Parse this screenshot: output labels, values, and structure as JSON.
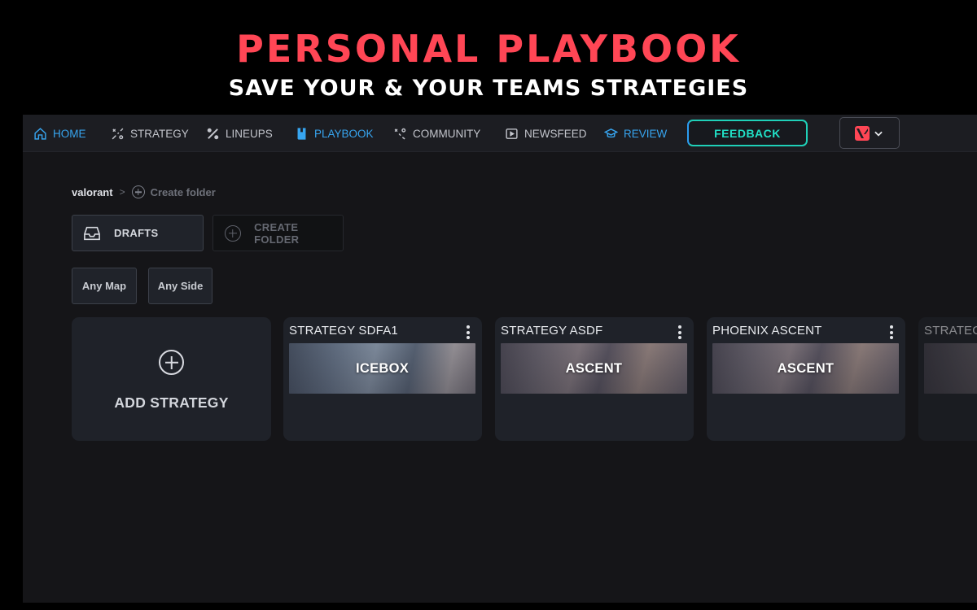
{
  "hero": {
    "title": "PERSONAL PLAYBOOK",
    "subtitle": "SAVE YOUR & YOUR TEAMS STRATEGIES"
  },
  "nav": {
    "items": [
      {
        "label": "HOME",
        "icon": "home-icon",
        "active": true
      },
      {
        "label": "STRATEGY",
        "icon": "strategy-icon",
        "active": false
      },
      {
        "label": "LINEUPS",
        "icon": "lineups-icon",
        "active": false
      },
      {
        "label": "PLAYBOOK",
        "icon": "book-icon",
        "active": true
      },
      {
        "label": "COMMUNITY",
        "icon": "community-icon",
        "active": false
      },
      {
        "label": "NEWSFEED",
        "icon": "play-icon",
        "active": false
      },
      {
        "label": "REVIEW",
        "icon": "graduation-cap-icon",
        "active": true
      }
    ],
    "feedback_label": "FEEDBACK",
    "game_select": {
      "icon": "valorant-logo",
      "chevron": "chevron-down-icon"
    }
  },
  "breadcrumb": {
    "root": "valorant",
    "separator": ">",
    "create_folder": "Create folder"
  },
  "folders": {
    "drafts": "DRAFTS",
    "create": "CREATE FOLDER"
  },
  "filters": {
    "map": "Any Map",
    "side": "Any Side"
  },
  "add_strategy_label": "ADD STRATEGY",
  "strategies": [
    {
      "title": "STRATEGY SDFA1",
      "map": "ICEBOX"
    },
    {
      "title": "STRATEGY ASDF",
      "map": "ASCENT"
    },
    {
      "title": "PHOENIX ASCENT",
      "map": "ASCENT"
    },
    {
      "title": "STRATEG",
      "map": ""
    }
  ],
  "colors": {
    "brand_red": "#ff4655",
    "active_blue": "#37a5f0",
    "feedback_teal": "#21e2c8"
  }
}
